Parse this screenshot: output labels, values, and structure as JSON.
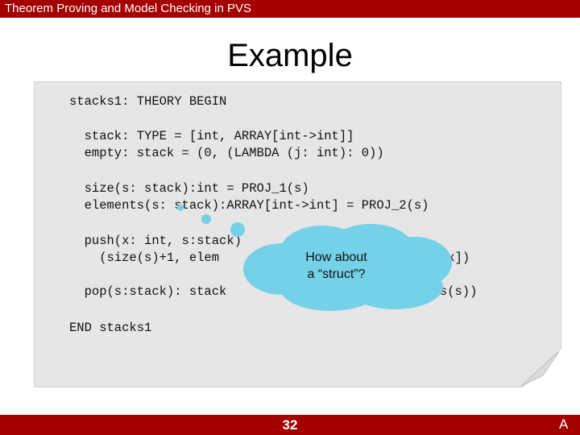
{
  "header": {
    "title": "Theorem Proving and Model Checking in PVS"
  },
  "slide": {
    "title": "Example",
    "code_lines": [
      "stacks1: THEORY BEGIN",
      "  stack: TYPE = [int, ARRAY[int->int]]",
      "  empty: stack = (0, (LAMBDA (j: int): 0))",
      "  size(s: stack):int = PROJ_1(s)",
      "  elements(s: stack):ARRAY[int->int] = PROJ_2(s)",
      "  push(x: int, s:stack)",
      "    (size(s)+1, elem",
      "=x])",
      "  pop(s:stack): stack",
      "ents(s))",
      "END stacks1"
    ],
    "callout": {
      "line1": "How about",
      "line2": "a “struct”?"
    }
  },
  "footer": {
    "page_number": "32",
    "letter": "A"
  },
  "colors": {
    "bar": "#a40000",
    "panel": "#e6e6e6",
    "cloud": "#74d1e8"
  }
}
